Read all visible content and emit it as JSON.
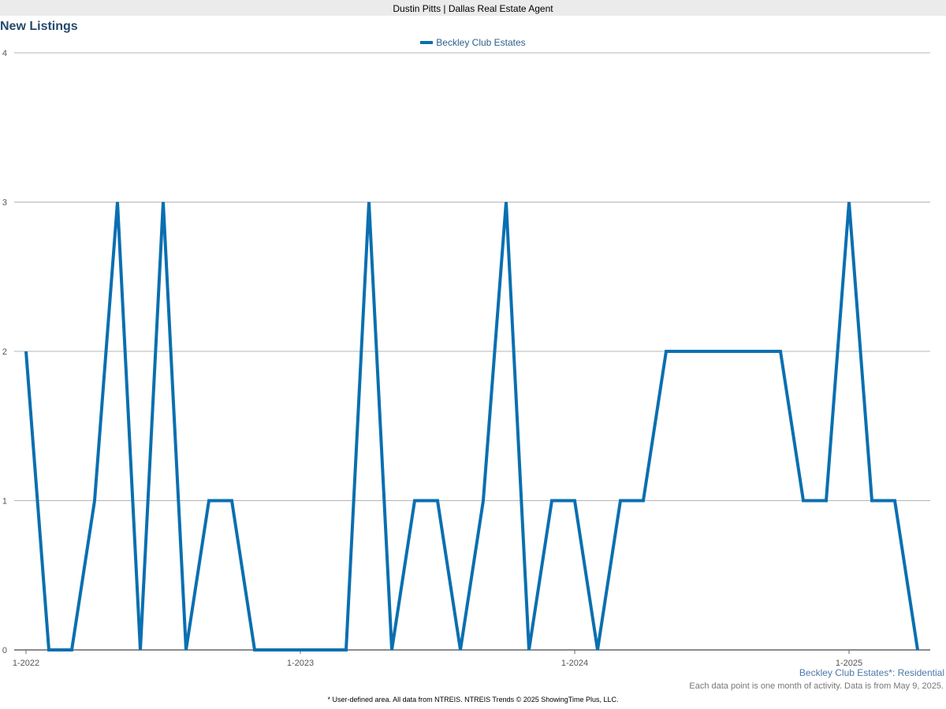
{
  "header": {
    "title": "Dustin Pitts | Dallas Real Estate Agent"
  },
  "chart_data": {
    "type": "line",
    "title": "New Listings",
    "xlabel": "",
    "ylabel": "",
    "ylim": [
      0,
      4
    ],
    "yticks": [
      "0",
      "1",
      "2",
      "3",
      "4"
    ],
    "xticks": [
      "1-2022",
      "1-2023",
      "1-2024",
      "1-2025"
    ],
    "grid": true,
    "legend": "top-center",
    "color": "#0a6fb0",
    "series": [
      {
        "name": "Beckley Club Estates",
        "start": "1-2022",
        "values": [
          2,
          0,
          0,
          1,
          3,
          0,
          3,
          0,
          1,
          1,
          0,
          0,
          0,
          0,
          0,
          3,
          0,
          1,
          1,
          0,
          1,
          3,
          0,
          1,
          1,
          0,
          1,
          1,
          2,
          2,
          2,
          2,
          2,
          2,
          1,
          1,
          3,
          1,
          1,
          0
        ]
      }
    ]
  },
  "area_label": "Beckley Club Estates*: Residential",
  "note": "Each data point is one month of activity. Data is from May 9, 2025.",
  "footer": "* User-defined area. All data from NTREIS. NTREIS Trends © 2025 ShowingTime Plus, LLC."
}
